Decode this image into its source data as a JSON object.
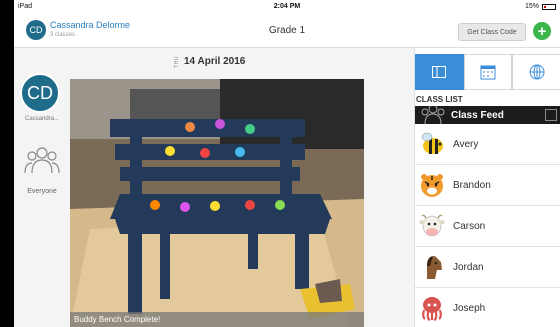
{
  "status_bar": {
    "device": "iPad",
    "time": "2:04 PM",
    "battery": "15%"
  },
  "header": {
    "avatar_initials": "CD",
    "user_name": "Cassandra Delorme",
    "class_count": "3 classes",
    "title": "Grade 1",
    "class_code_label": "Get Class Code",
    "add_label": "+"
  },
  "rail": {
    "avatar_initials": "CD",
    "avatar_label": "Cassandra...",
    "everyone_label": "Everyone"
  },
  "feed": {
    "day_of_week": "THU",
    "date": "14 April 2016",
    "caption": "Buddy Bench Complete!"
  },
  "panel": {
    "tabs": [
      {
        "icon": "list-view-icon",
        "active": true
      },
      {
        "icon": "calendar-icon",
        "active": false
      },
      {
        "icon": "globe-icon",
        "active": false
      }
    ],
    "section_label": "CLASS LIST",
    "feed_item": "Class Feed",
    "students": [
      {
        "name": "Avery",
        "avatar": "bee"
      },
      {
        "name": "Brandon",
        "avatar": "tiger"
      },
      {
        "name": "Carson",
        "avatar": "cow"
      },
      {
        "name": "Jordan",
        "avatar": "horse"
      },
      {
        "name": "Joseph",
        "avatar": "octopus"
      }
    ]
  },
  "colors": {
    "accent": "#3a8ed8",
    "brand_teal": "#1e6b8a",
    "add_green": "#3cb54a"
  }
}
